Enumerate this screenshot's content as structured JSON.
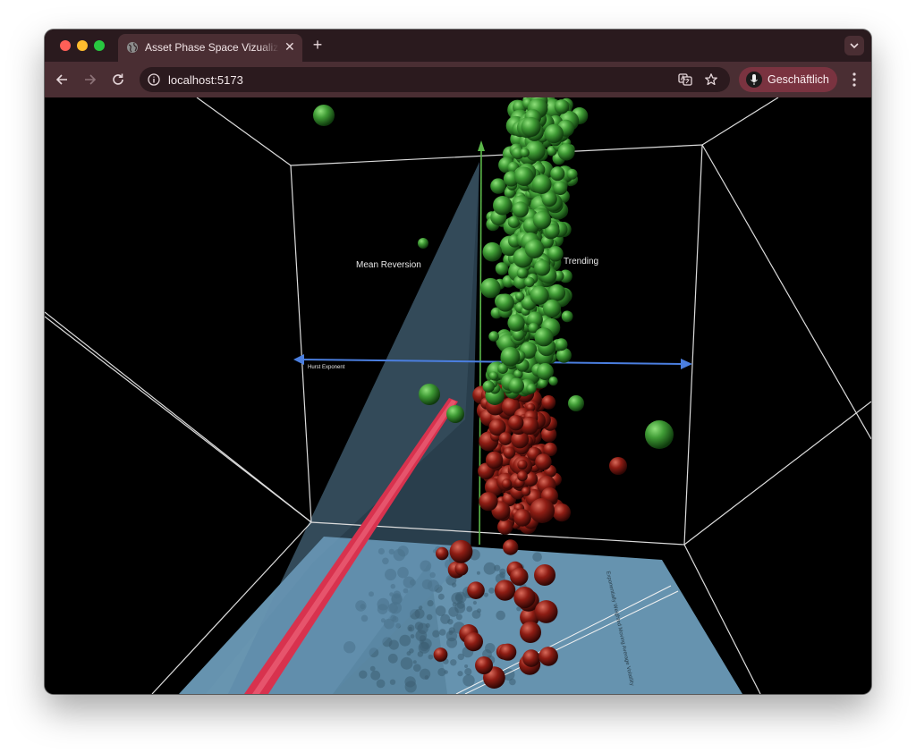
{
  "browser": {
    "tab": {
      "title": "Asset Phase Space Vizualization"
    },
    "address_bar": {
      "url": "localhost:5173"
    },
    "profile": {
      "label": "Geschäftlich"
    }
  },
  "scene": {
    "labels": {
      "mean_reversion": "Mean Reversion",
      "trending": "Trending",
      "hurst_axis": "Hurst Exponent",
      "floor_axis": "Exponentially Weighted Moving Average Volatility"
    },
    "colors": {
      "trending_sphere": "#3f9b35",
      "mean_reversion_sphere": "#8e1d14",
      "hurst_axis": "#4b7fe0",
      "threshold_plane": "#5a89a8",
      "floor_plane": "#6b9bb8",
      "trend_line": "#d8324e",
      "vertical_axis": "#5cb84a"
    }
  }
}
